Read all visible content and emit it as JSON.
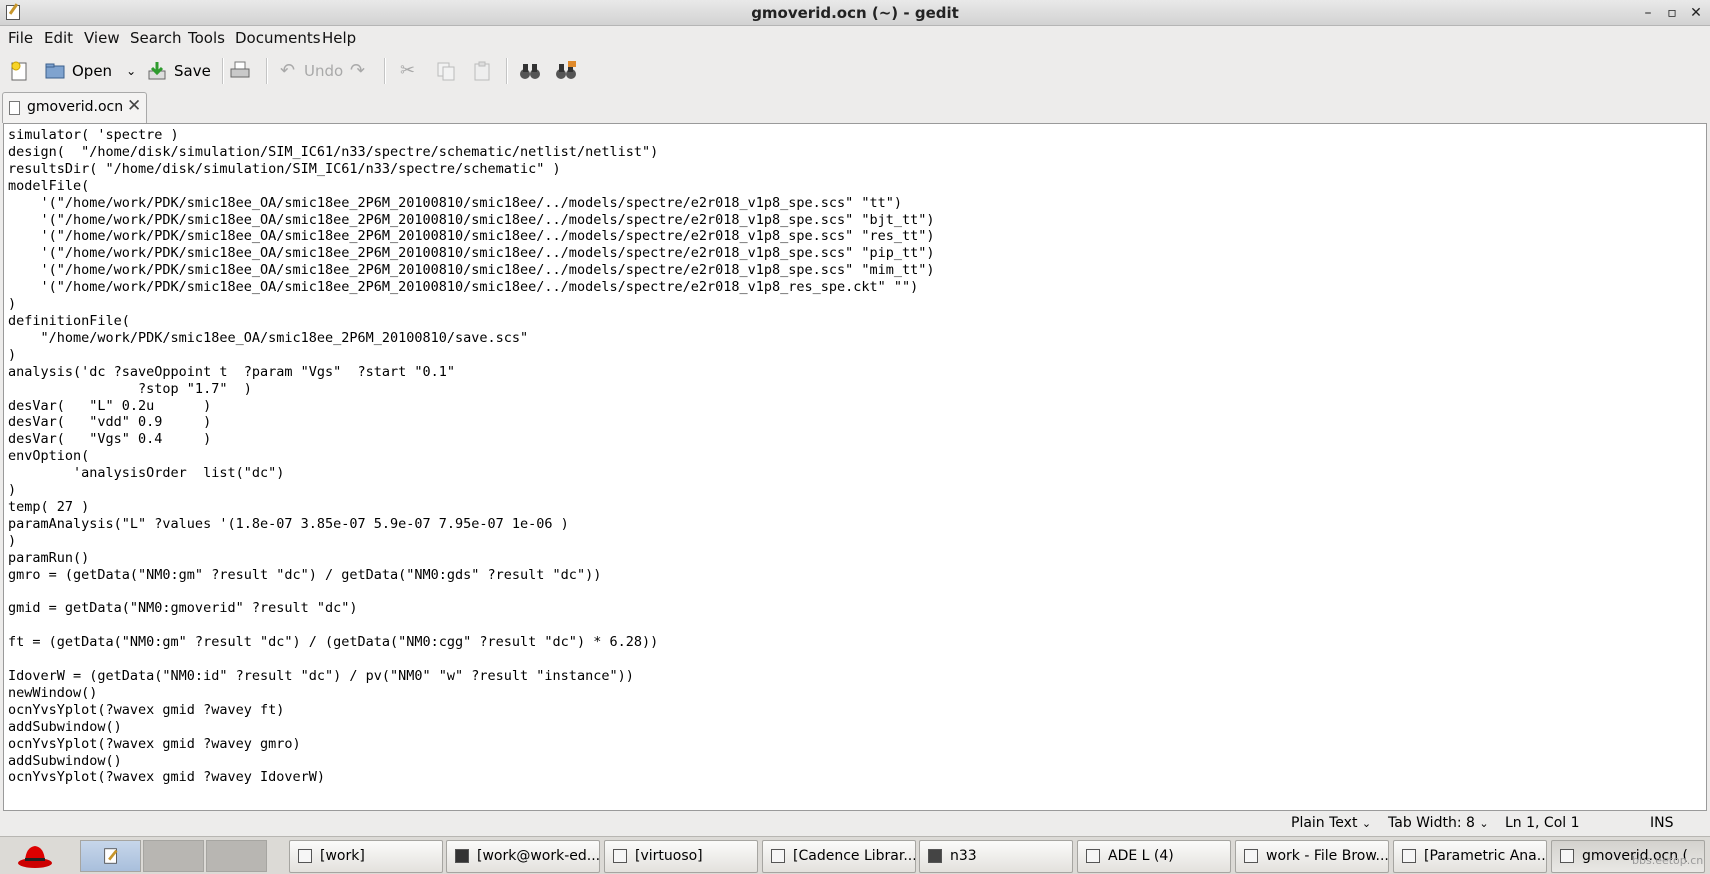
{
  "window": {
    "title": "gmoverid.ocn (~) - gedit",
    "controls": {
      "minimize": "–",
      "maximize": "▫",
      "close": "✕"
    }
  },
  "menu": [
    "File",
    "Edit",
    "View",
    "Search",
    "Tools",
    "Documents",
    "Help"
  ],
  "toolbar": {
    "open_label": "Open",
    "save_label": "Save",
    "undo_label": "Undo"
  },
  "tab": {
    "label": "gmoverid.ocn",
    "close_glyph": "✕"
  },
  "editor": {
    "text": "simulator( 'spectre )\ndesign(  \"/home/disk/simulation/SIM_IC61/n33/spectre/schematic/netlist/netlist\")\nresultsDir( \"/home/disk/simulation/SIM_IC61/n33/spectre/schematic\" )\nmodelFile(\n    '(\"/home/work/PDK/smic18ee_OA/smic18ee_2P6M_20100810/smic18ee/../models/spectre/e2r018_v1p8_spe.scs\" \"tt\")\n    '(\"/home/work/PDK/smic18ee_OA/smic18ee_2P6M_20100810/smic18ee/../models/spectre/e2r018_v1p8_spe.scs\" \"bjt_tt\")\n    '(\"/home/work/PDK/smic18ee_OA/smic18ee_2P6M_20100810/smic18ee/../models/spectre/e2r018_v1p8_spe.scs\" \"res_tt\")\n    '(\"/home/work/PDK/smic18ee_OA/smic18ee_2P6M_20100810/smic18ee/../models/spectre/e2r018_v1p8_spe.scs\" \"pip_tt\")\n    '(\"/home/work/PDK/smic18ee_OA/smic18ee_2P6M_20100810/smic18ee/../models/spectre/e2r018_v1p8_spe.scs\" \"mim_tt\")\n    '(\"/home/work/PDK/smic18ee_OA/smic18ee_2P6M_20100810/smic18ee/../models/spectre/e2r018_v1p8_res_spe.ckt\" \"\")\n)\ndefinitionFile(\n    \"/home/work/PDK/smic18ee_OA/smic18ee_2P6M_20100810/save.scs\"\n)\nanalysis('dc ?saveOppoint t  ?param \"Vgs\"  ?start \"0.1\"\n                ?stop \"1.7\"  )\ndesVar(   \"L\" 0.2u      )\ndesVar(   \"vdd\" 0.9     )\ndesVar(   \"Vgs\" 0.4     )\nenvOption(\n        'analysisOrder  list(\"dc\")\n)\ntemp( 27 )\nparamAnalysis(\"L\" ?values '(1.8e-07 3.85e-07 5.9e-07 7.95e-07 1e-06 )\n)\nparamRun()\ngmro = (getData(\"NM0:gm\" ?result \"dc\") / getData(\"NM0:gds\" ?result \"dc\"))\n\ngmid = getData(\"NM0:gmoverid\" ?result \"dc\")\n\nft = (getData(\"NM0:gm\" ?result \"dc\") / (getData(\"NM0:cgg\" ?result \"dc\") * 6.28))\n\nIdoverW = (getData(\"NM0:id\" ?result \"dc\") / pv(\"NM0\" \"w\" ?result \"instance\"))\nnewWindow()\nocnYvsYplot(?wavex gmid ?wavey ft)\naddSubwindow()\nocnYvsYplot(?wavex gmid ?wavey gmro)\naddSubwindow()\nocnYvsYplot(?wavex gmid ?wavey IdoverW)"
  },
  "statusbar": {
    "language": "Plain Text",
    "tab_width": "Tab Width:  8",
    "position": "Ln 1, Col 1",
    "mode": "INS"
  },
  "taskbar": {
    "tasks": [
      {
        "label": "[work]",
        "icon": "folder-icon"
      },
      {
        "label": "[work@work-ed...",
        "icon": "terminal-icon"
      },
      {
        "label": "[virtuoso]",
        "icon": "virtuoso-icon"
      },
      {
        "label": "[Cadence Librar...",
        "icon": "window-icon"
      },
      {
        "label": "n33",
        "icon": "schematic-icon"
      },
      {
        "label": "ADE L (4)",
        "icon": "ade-icon"
      },
      {
        "label": "work - File Brow...",
        "icon": "filebrowser-icon"
      },
      {
        "label": "[Parametric Ana...",
        "icon": "window-icon"
      },
      {
        "label": "gmoverid.ocn (",
        "icon": "gedit-icon"
      }
    ],
    "watermark": "bbs.eetop.cn"
  }
}
